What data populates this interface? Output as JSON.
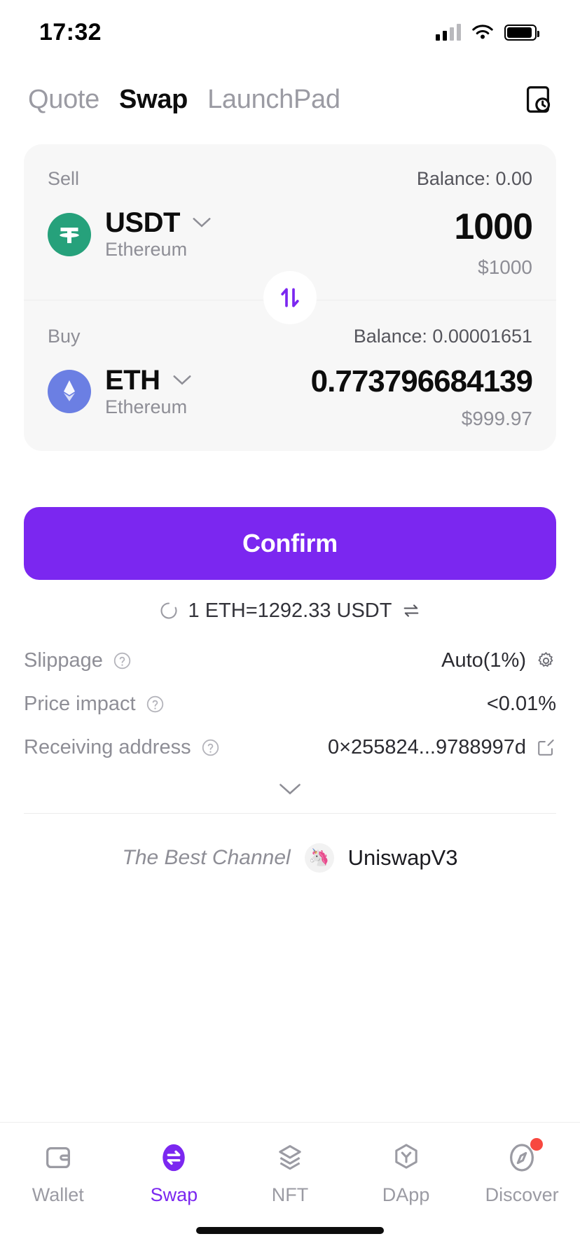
{
  "status_bar": {
    "time": "17:32",
    "cellular_icon": "signal-bars-icon",
    "wifi_icon": "wifi-icon",
    "battery_icon": "battery-icon"
  },
  "header": {
    "tabs": [
      {
        "label": "Quote",
        "active": false
      },
      {
        "label": "Swap",
        "active": true
      },
      {
        "label": "LaunchPad",
        "active": false
      }
    ],
    "history_icon": "history-clock-icon"
  },
  "swap_card": {
    "sell": {
      "section_label": "Sell",
      "balance_label": "Balance: 0.00",
      "token_symbol": "USDT",
      "token_network": "Ethereum",
      "token_logo": "tether-icon",
      "amount": "1000",
      "fiat_value": "$1000"
    },
    "buy": {
      "section_label": "Buy",
      "balance_label": "Balance: 0.00001651",
      "token_symbol": "ETH",
      "token_network": "Ethereum",
      "token_logo": "ethereum-icon",
      "amount": "0.773796684139",
      "fiat_value": "$999.97"
    },
    "switch_icon": "swap-direction-icon"
  },
  "confirm": {
    "label": "Confirm",
    "color": "#7b27f0"
  },
  "rate": {
    "loading_icon": "spinner-icon",
    "text": "1 ETH=1292.33 USDT",
    "toggle_icon": "rate-toggle-icon"
  },
  "details": {
    "rows": [
      {
        "label": "Slippage",
        "help_icon": "question-circle-icon",
        "value": "Auto(1%)",
        "action_icon": "gear-icon"
      },
      {
        "label": "Price impact",
        "help_icon": "question-circle-icon",
        "value": "<0.01%",
        "action_icon": ""
      },
      {
        "label": "Receiving address",
        "help_icon": "question-circle-icon",
        "value": "0×255824...9788997d",
        "action_icon": "edit-icon"
      }
    ],
    "expand_icon": "chevron-down-icon"
  },
  "channel": {
    "label": "The Best Channel",
    "logo_icon": "unicorn-icon",
    "name": "UniswapV3"
  },
  "bottom_nav": {
    "items": [
      {
        "label": "Wallet",
        "icon": "wallet-icon",
        "active": false,
        "badge": false
      },
      {
        "label": "Swap",
        "icon": "swap-icon",
        "active": true,
        "badge": false
      },
      {
        "label": "NFT",
        "icon": "layers-icon",
        "active": false,
        "badge": false
      },
      {
        "label": "DApp",
        "icon": "hexagon-icon",
        "active": false,
        "badge": false
      },
      {
        "label": "Discover",
        "icon": "compass-icon",
        "active": false,
        "badge": true
      }
    ],
    "active_color": "#7b27f0",
    "badge_color": "#f8483f"
  }
}
